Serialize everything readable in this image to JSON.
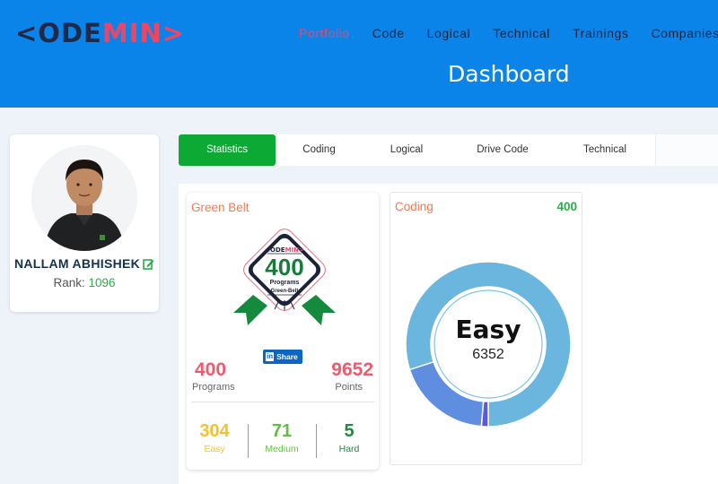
{
  "header": {
    "logo_left": "<ODE",
    "logo_right": "MIN>",
    "nav": [
      "Portfolio",
      "Code",
      "Logical",
      "Technical",
      "Trainings",
      "Companies"
    ],
    "active_nav": "Portfolio",
    "title": "Dashboard"
  },
  "profile": {
    "name": "NALLAM ABHISHEK",
    "rank_label": "Rank:",
    "rank_value": "1096"
  },
  "tabs": [
    "Statistics",
    "Coding",
    "Logical",
    "Drive Code",
    "Technical"
  ],
  "active_tab": "Statistics",
  "belt": {
    "title": "Green Belt",
    "badge": {
      "brand_left": "<ODE",
      "brand_right": "MIN>",
      "number": "400",
      "line1": "Programs",
      "line2": "Green-Belt"
    },
    "share_icon": "in",
    "share_label": "Share",
    "programs_value": "400",
    "programs_label": "Programs",
    "points_value": "9652",
    "points_label": "Points",
    "easy_value": "304",
    "easy_label": "Easy",
    "medium_value": "71",
    "medium_label": "Medium",
    "hard_value": "5",
    "hard_label": "Hard"
  },
  "coding": {
    "title": "Coding",
    "count": "400",
    "center_label": "Easy",
    "center_value": "6352"
  },
  "chart_data": {
    "type": "pie",
    "categories": [
      "Easy",
      "Medium",
      "Hard"
    ],
    "values": [
      304,
      71,
      5
    ],
    "colors": [
      "#6ab6df",
      "#5f8ee0",
      "#5b5bd6"
    ]
  },
  "colors": {
    "header_bg": "#0b84ea",
    "accent_red": "#ef4565",
    "green": "#0ca934",
    "easy": "#f6c22c",
    "medium": "#5fbf3f",
    "hard": "#1e8a3c"
  }
}
